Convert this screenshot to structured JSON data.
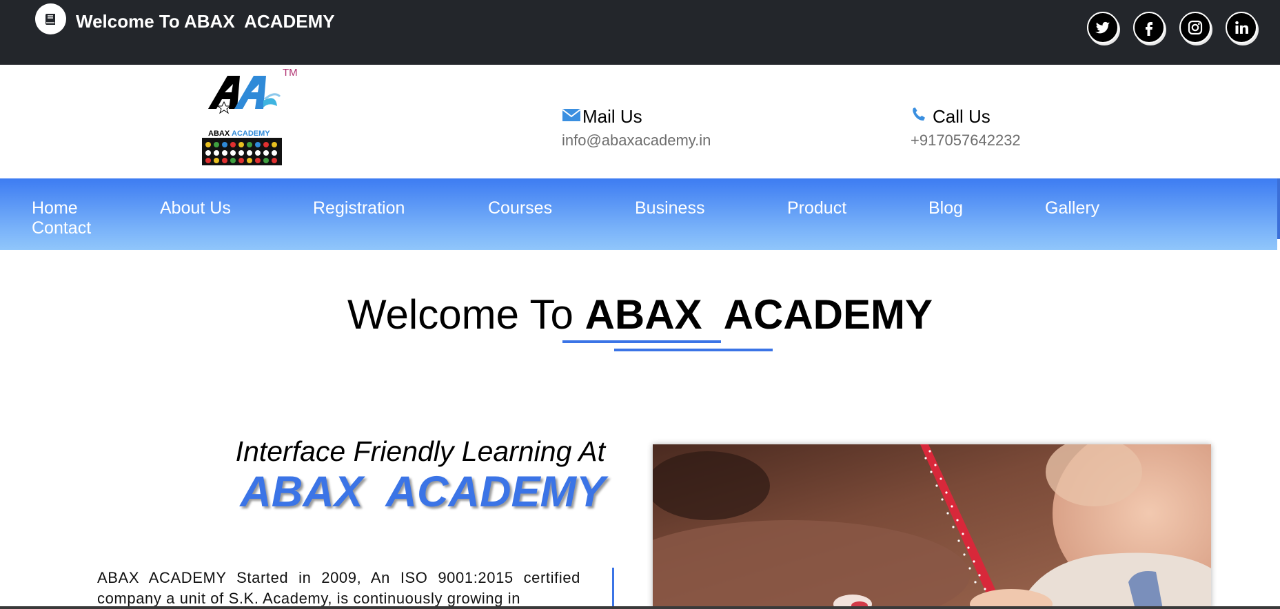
{
  "topbar": {
    "title": "Welcome To ABAX  ACADEMY",
    "logo_icon": "book-icon",
    "social": [
      {
        "name": "twitter-icon"
      },
      {
        "name": "facebook-icon"
      },
      {
        "name": "instagram-icon"
      },
      {
        "name": "linkedin-icon"
      }
    ]
  },
  "header": {
    "logo": {
      "tm": "TM",
      "text_abax": "ABAX",
      "text_academy": "ACADEMY"
    },
    "mail": {
      "label": "Mail Us",
      "value": "info@abaxacademy.in",
      "icon": "envelope-icon"
    },
    "call": {
      "label": "Call Us",
      "value": "+917057642232",
      "icon": "phone-icon"
    }
  },
  "nav": {
    "items": [
      {
        "label": "Home"
      },
      {
        "label": "About Us"
      },
      {
        "label": "Registration"
      },
      {
        "label": "Courses"
      },
      {
        "label": "Business"
      },
      {
        "label": "Product"
      },
      {
        "label": "Blog"
      },
      {
        "label": "Gallery"
      },
      {
        "label": "Contact"
      }
    ]
  },
  "welcome": {
    "prefix": "Welcome To ",
    "brand": "ABAX  ACADEMY"
  },
  "intro": {
    "line1": "Interface Friendly Learning At",
    "brand": "ABAX  ACADEMY",
    "paragraph": "ABAX ACADEMY Started in 2009, An ISO 9001:2015 certified company a unit of S.K. Academy, is continuously growing in"
  },
  "colors": {
    "topbar_bg": "#23262b",
    "nav_gradient_top": "#3d7cf2",
    "nav_gradient_bottom": "#90c6fb",
    "accent": "#3b74e6"
  }
}
